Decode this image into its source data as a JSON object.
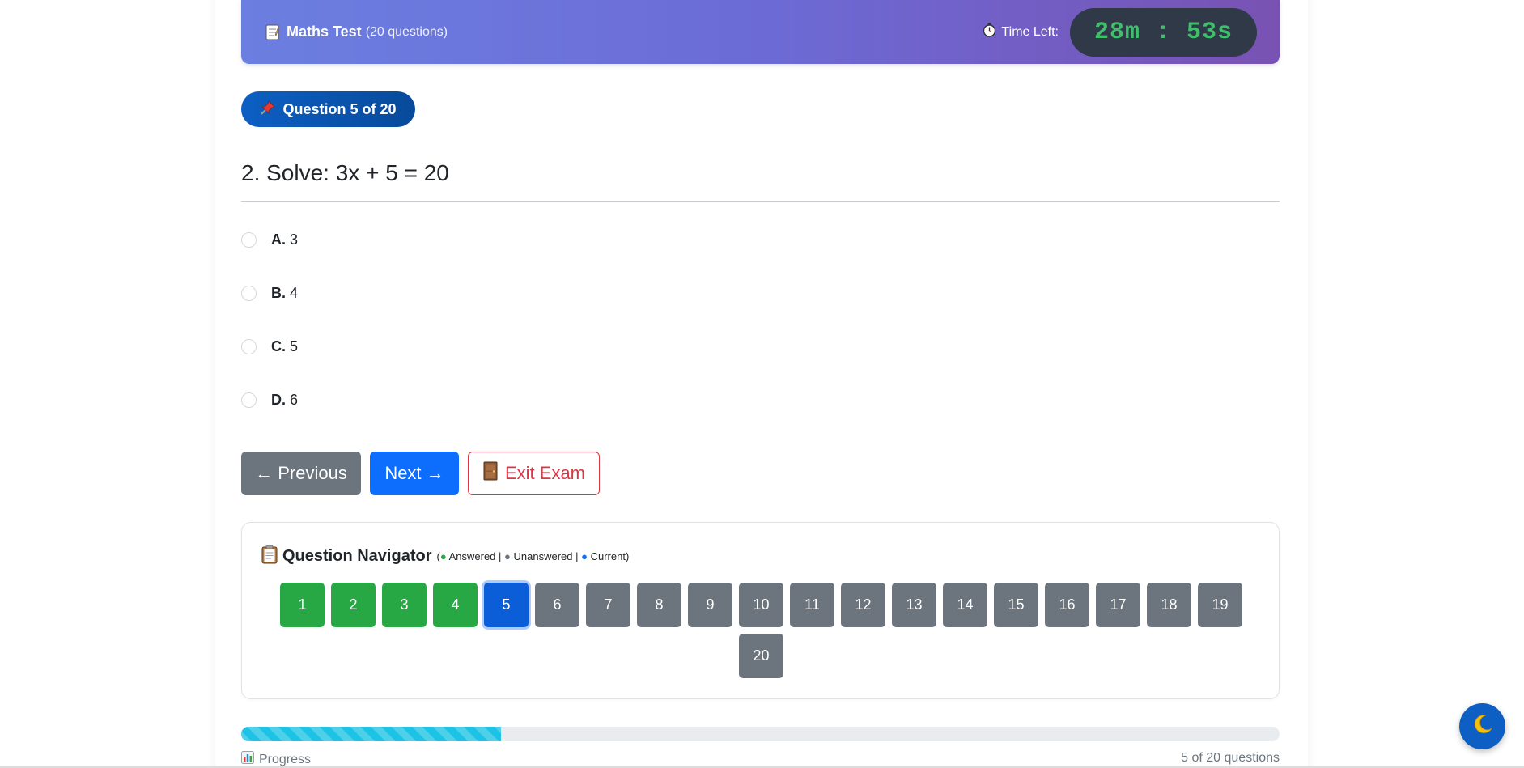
{
  "header": {
    "title": "Maths Test",
    "question_count": "(20 questions)",
    "timer_label": "Time Left:",
    "timer_value": "28m : 53s",
    "icons": {
      "title": "memo-icon",
      "timer": "stopwatch-icon"
    }
  },
  "question": {
    "badge": "Question 5 of 20",
    "text": "2. Solve: 3x + 5 = 20",
    "options": [
      {
        "letter": "A.",
        "text": "3"
      },
      {
        "letter": "B.",
        "text": "4"
      },
      {
        "letter": "C.",
        "text": "5"
      },
      {
        "letter": "D.",
        "text": "6"
      }
    ]
  },
  "actions": {
    "previous": "← Previous",
    "next": "Next →",
    "exit": "Exit Exam"
  },
  "navigator": {
    "title": "Question Navigator",
    "legend_open": "(",
    "legend_answered": "Answered |",
    "legend_unanswered": "Unanswered |",
    "legend_current": "Current)",
    "buttons": [
      {
        "label": "1",
        "state": "answered"
      },
      {
        "label": "2",
        "state": "answered"
      },
      {
        "label": "3",
        "state": "answered"
      },
      {
        "label": "4",
        "state": "answered"
      },
      {
        "label": "5",
        "state": "current"
      },
      {
        "label": "6",
        "state": "unanswered"
      },
      {
        "label": "7",
        "state": "unanswered"
      },
      {
        "label": "8",
        "state": "unanswered"
      },
      {
        "label": "9",
        "state": "unanswered"
      },
      {
        "label": "10",
        "state": "unanswered"
      },
      {
        "label": "11",
        "state": "unanswered"
      },
      {
        "label": "12",
        "state": "unanswered"
      },
      {
        "label": "13",
        "state": "unanswered"
      },
      {
        "label": "14",
        "state": "unanswered"
      },
      {
        "label": "15",
        "state": "unanswered"
      },
      {
        "label": "16",
        "state": "unanswered"
      },
      {
        "label": "17",
        "state": "unanswered"
      },
      {
        "label": "18",
        "state": "unanswered"
      },
      {
        "label": "19",
        "state": "unanswered"
      },
      {
        "label": "20",
        "state": "unanswered"
      }
    ]
  },
  "progress": {
    "label": "Progress",
    "count": "5 of 20 questions",
    "fraction": 0.25
  },
  "colors": {
    "answered": "#28a745",
    "unanswered": "#6c757d",
    "current": "#0b5ed7",
    "timer_text": "#3fbf6c",
    "progress": "#1cc3e6"
  }
}
